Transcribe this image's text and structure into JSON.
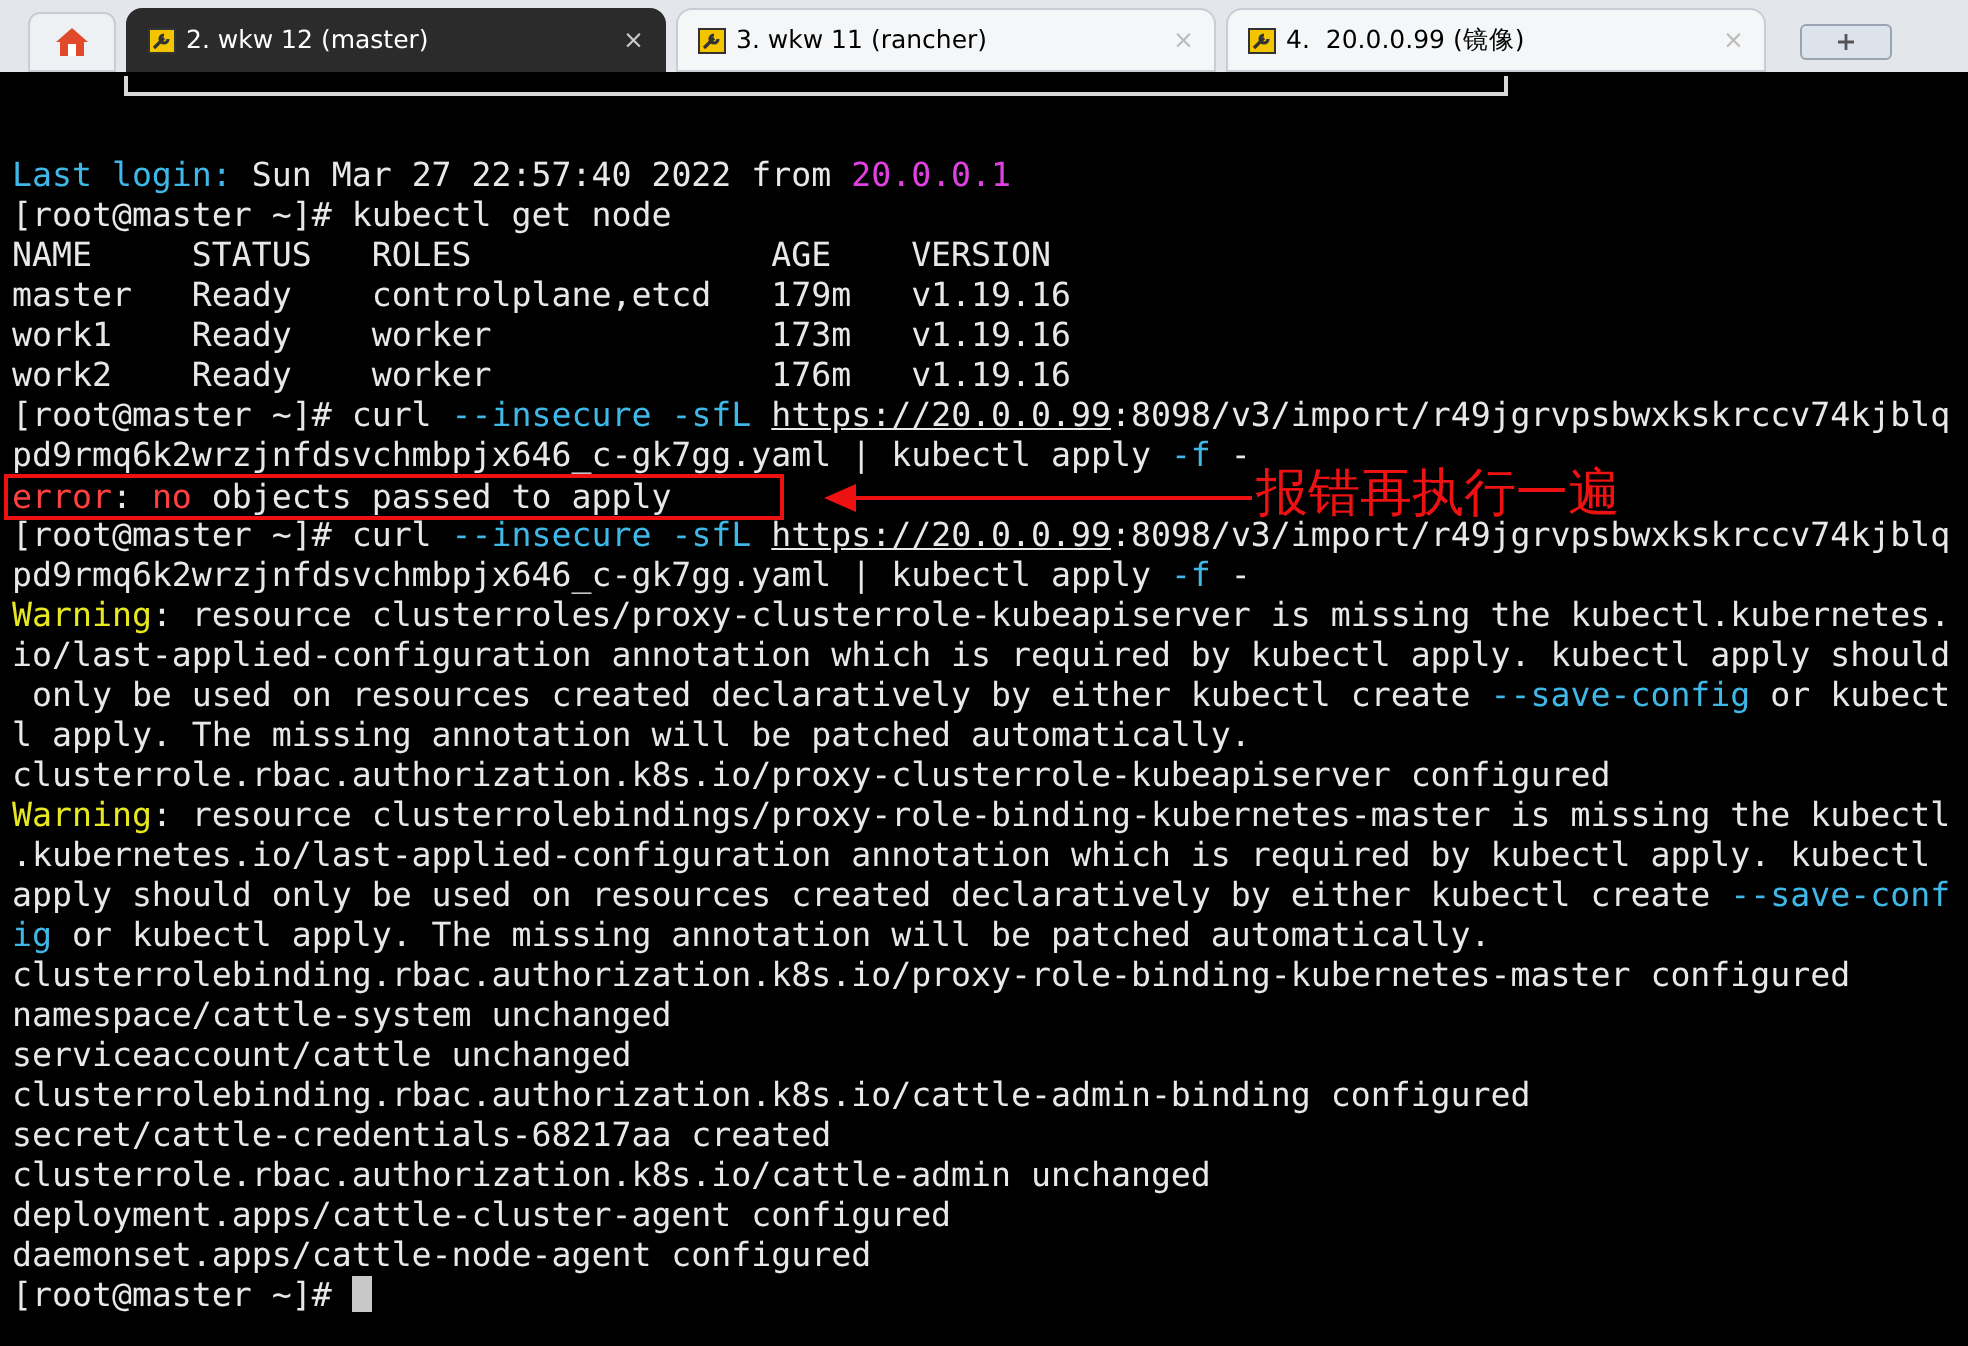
{
  "tabs": [
    {
      "label": "2. wkw 12 (master)",
      "close": "×",
      "selected": true
    },
    {
      "label": "3. wkw 11 (rancher)",
      "close": "×",
      "selected": false
    },
    {
      "label": "4.  20.0.0.99 (镜像)",
      "close": "×",
      "selected": false
    }
  ],
  "terminal": {
    "lines": [
      {
        "segments": [
          {
            "text": "Last login:",
            "kind": "label"
          },
          {
            "text": " Sun Mar 27 22:57:40 2022 from ",
            "kind": "text"
          },
          {
            "text": "20.0.0.1",
            "kind": "host"
          }
        ]
      },
      {
        "segments": [
          {
            "text": "[root@master ~]# kubectl get node",
            "kind": "text"
          }
        ]
      },
      {
        "segments": [
          {
            "text": "NAME     STATUS   ROLES               AGE    VERSION",
            "kind": "text"
          }
        ]
      },
      {
        "segments": [
          {
            "text": "master   Ready    controlplane,etcd   179m   v1.19.16",
            "kind": "text"
          }
        ]
      },
      {
        "segments": [
          {
            "text": "work1    Ready    worker              173m   v1.19.16",
            "kind": "text"
          }
        ]
      },
      {
        "segments": [
          {
            "text": "work2    Ready    worker              176m   v1.19.16",
            "kind": "text"
          }
        ]
      },
      {
        "segments": [
          {
            "text": "[root@master ~]# curl ",
            "kind": "text"
          },
          {
            "text": "--insecure ",
            "kind": "option"
          },
          {
            "text": "-sfL ",
            "kind": "option"
          },
          {
            "text": "https://20.0.0.99",
            "kind": "url"
          },
          {
            "text": ":8098/v3/import/r49jgrvpsbwxkskrccv74kjblq",
            "kind": "text"
          }
        ]
      },
      {
        "segments": [
          {
            "text": "pd9rmq6k2wrzjnfdsvchmbpjx646_c-gk7gg.yaml | kubectl apply ",
            "kind": "text"
          },
          {
            "text": "-f",
            "kind": "option"
          },
          {
            "text": " -",
            "kind": "text"
          }
        ]
      },
      {
        "segments": [
          {
            "text": "error",
            "kind": "error"
          },
          {
            "text": ": ",
            "kind": "text"
          },
          {
            "text": "no",
            "kind": "error"
          },
          {
            "text": " objects passed to apply",
            "kind": "text"
          }
        ],
        "highlighted": true
      },
      {
        "segments": [
          {
            "text": "[root@master ~]# curl ",
            "kind": "text"
          },
          {
            "text": "--insecure ",
            "kind": "option"
          },
          {
            "text": "-sfL ",
            "kind": "option"
          },
          {
            "text": "https://20.0.0.99",
            "kind": "url"
          },
          {
            "text": ":8098/v3/import/r49jgrvpsbwxkskrccv74kjblq",
            "kind": "text"
          }
        ]
      },
      {
        "segments": [
          {
            "text": "pd9rmq6k2wrzjnfdsvchmbpjx646_c-gk7gg.yaml | kubectl apply ",
            "kind": "text"
          },
          {
            "text": "-f",
            "kind": "option"
          },
          {
            "text": " -",
            "kind": "text"
          }
        ]
      },
      {
        "segments": [
          {
            "text": "Warning",
            "kind": "warning"
          },
          {
            "text": ": resource clusterroles/proxy-clusterrole-kubeapiserver is missing the kubectl.kubernetes.",
            "kind": "text"
          }
        ]
      },
      {
        "segments": [
          {
            "text": "io/last-applied-configuration annotation which is required by kubectl apply. kubectl apply should",
            "kind": "text"
          }
        ]
      },
      {
        "segments": [
          {
            "text": " only be used on resources created declaratively by either kubectl create ",
            "kind": "text"
          },
          {
            "text": "--save-config",
            "kind": "option"
          },
          {
            "text": " or kubect",
            "kind": "text"
          }
        ]
      },
      {
        "segments": [
          {
            "text": "l apply. The missing annotation will be patched automatically.",
            "kind": "text"
          }
        ]
      },
      {
        "segments": [
          {
            "text": "clusterrole.rbac.authorization.k8s.io/proxy-clusterrole-kubeapiserver configured",
            "kind": "text"
          }
        ]
      },
      {
        "segments": [
          {
            "text": "Warning",
            "kind": "warning"
          },
          {
            "text": ": resource clusterrolebindings/proxy-role-binding-kubernetes-master is missing the kubectl",
            "kind": "text"
          }
        ]
      },
      {
        "segments": [
          {
            "text": ".kubernetes.io/last-applied-configuration annotation which is required by kubectl apply. kubectl",
            "kind": "text"
          }
        ]
      },
      {
        "segments": [
          {
            "text": "apply should only be used on resources created declaratively by either kubectl create ",
            "kind": "text"
          },
          {
            "text": "--save-conf",
            "kind": "option"
          }
        ]
      },
      {
        "segments": [
          {
            "text": "ig",
            "kind": "option"
          },
          {
            "text": " or kubectl apply. The missing annotation will be patched automatically.",
            "kind": "text"
          }
        ]
      },
      {
        "segments": [
          {
            "text": "clusterrolebinding.rbac.authorization.k8s.io/proxy-role-binding-kubernetes-master configured",
            "kind": "text"
          }
        ]
      },
      {
        "segments": [
          {
            "text": "namespace/cattle-system unchanged",
            "kind": "text"
          }
        ]
      },
      {
        "segments": [
          {
            "text": "serviceaccount/cattle unchanged",
            "kind": "text"
          }
        ]
      },
      {
        "segments": [
          {
            "text": "clusterrolebinding.rbac.authorization.k8s.io/cattle-admin-binding configured",
            "kind": "text"
          }
        ]
      },
      {
        "segments": [
          {
            "text": "secret/cattle-credentials-68217aa created",
            "kind": "text"
          }
        ]
      },
      {
        "segments": [
          {
            "text": "clusterrole.rbac.authorization.k8s.io/cattle-admin unchanged",
            "kind": "text"
          }
        ]
      },
      {
        "segments": [
          {
            "text": "deployment.apps/cattle-cluster-agent configured",
            "kind": "text"
          }
        ]
      },
      {
        "segments": [
          {
            "text": "daemonset.apps/cattle-node-agent configured",
            "kind": "text"
          }
        ]
      },
      {
        "segments": [
          {
            "text": "[root@master ~]# ",
            "kind": "text"
          }
        ],
        "cursor": true
      }
    ]
  },
  "annotation": {
    "text": "报错再执行一遍"
  }
}
